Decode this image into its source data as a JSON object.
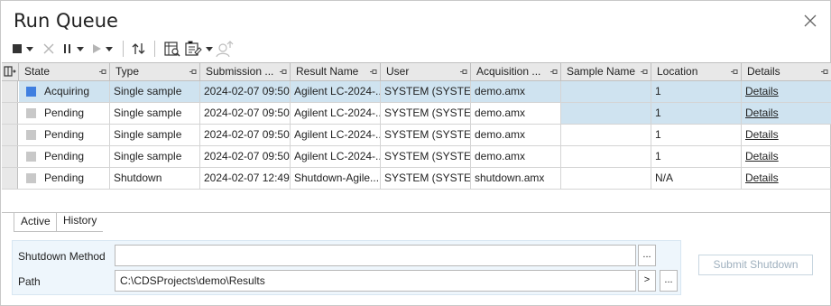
{
  "window": {
    "title": "Run Queue"
  },
  "toolbar": {
    "stop": "stop-icon",
    "abort": "abort-icon",
    "pause": "pause-icon",
    "resume": "play-icon",
    "move": "move-icon",
    "queue_properties": "queue-properties-icon",
    "plan": "plan-icon",
    "user": "user-icon"
  },
  "columns": [
    "State",
    "Type",
    "Submission ...",
    "Result Name",
    "User",
    "Acquisition ...",
    "Sample Name",
    "Location",
    "Details"
  ],
  "rows": [
    {
      "state": "Acquiring",
      "state_color": "#3f7fe0",
      "type": "Single sample",
      "submission": "2024-02-07 09:50...",
      "result_name": "Agilent LC-2024-...",
      "user": "SYSTEM (SYSTEM)",
      "acquisition": "demo.amx",
      "sample_name": "",
      "location": "1",
      "details": "Details"
    },
    {
      "state": "Pending",
      "state_color": "#c8c8c8",
      "type": "Single sample",
      "submission": "2024-02-07 09:50...",
      "result_name": "Agilent LC-2024-...",
      "user": "SYSTEM (SYSTEM)",
      "acquisition": "demo.amx",
      "sample_name": "",
      "location": "1",
      "details": "Details"
    },
    {
      "state": "Pending",
      "state_color": "#c8c8c8",
      "type": "Single sample",
      "submission": "2024-02-07 09:50...",
      "result_name": "Agilent LC-2024-...",
      "user": "SYSTEM (SYSTEM)",
      "acquisition": "demo.amx",
      "sample_name": "",
      "location": "1",
      "details": "Details"
    },
    {
      "state": "Pending",
      "state_color": "#c8c8c8",
      "type": "Single sample",
      "submission": "2024-02-07 09:50...",
      "result_name": "Agilent LC-2024-...",
      "user": "SYSTEM (SYSTEM)",
      "acquisition": "demo.amx",
      "sample_name": "",
      "location": "1",
      "details": "Details"
    },
    {
      "state": "Pending",
      "state_color": "#c8c8c8",
      "type": "Shutdown",
      "submission": "2024-02-07 12:49...",
      "result_name": "Shutdown-Agile...",
      "user": "SYSTEM (SYSTEM)",
      "acquisition": "shutdown.amx",
      "sample_name": "",
      "location": "N/A",
      "details": "Details"
    }
  ],
  "tabs": [
    "Active",
    "History"
  ],
  "shutdown": {
    "method_label": "Shutdown Method",
    "method_value": "",
    "path_label": "Path",
    "path_value": "C:\\CDSProjects\\demo\\Results",
    "browse": "...",
    "arrow": ">",
    "submit_label": "Submit Shutdown"
  }
}
